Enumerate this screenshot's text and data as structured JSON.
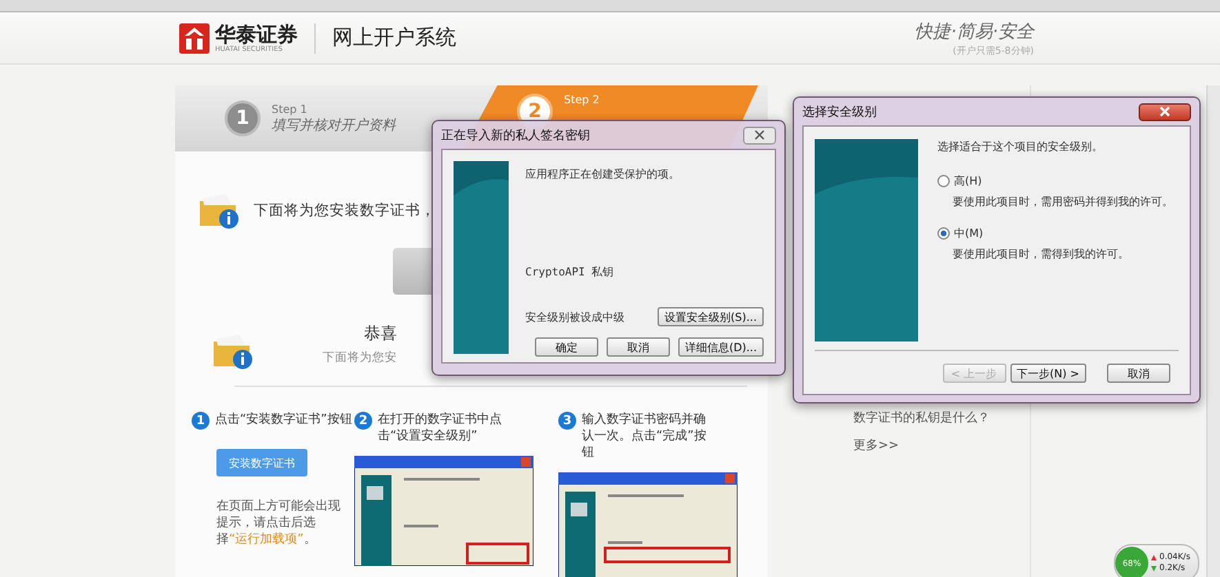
{
  "header": {
    "brand": "华泰证券",
    "brand_sub": "HUATAI SECURITIES",
    "title": "网上开户系统",
    "slogan": "快捷·简易·安全",
    "slogan_note": "(开户只需5-8分钟)"
  },
  "steps": [
    {
      "label": "Step 1",
      "number": "1",
      "title": "填写并核对开户资料",
      "selected": false
    },
    {
      "label": "Step 2",
      "number": "2",
      "selected": true
    }
  ],
  "notices": [
    {
      "kind": "line",
      "text": "下面将为您安装数字证书，"
    },
    {
      "kind": "heading",
      "heading": "恭喜",
      "text": "下面将为您安"
    }
  ],
  "guide": [
    {
      "kind": "button",
      "number": "1",
      "text": "点击“安装数字证书”按钮",
      "button": "安装数字证书",
      "note": [
        {
          "text": "在页面上方可能会出现提示，请点击后选择",
          "highlight": false
        },
        {
          "text": "“运行加载项”",
          "highlight": true
        },
        {
          "text": "。",
          "highlight": false
        }
      ]
    },
    {
      "kind": "screenshot",
      "number": "2",
      "text": "在打开的数字证书中点击“设置安全级别”"
    },
    {
      "kind": "screenshot",
      "number": "3",
      "text": "输入数字证书密码并确认一次。点击“完成”按钮"
    }
  ],
  "sidebar_links": [
    "数字证书的私钥是什么？",
    "更多>>"
  ],
  "import_dialog": {
    "title": "正在导入新的私人签名密钥",
    "message": "应用程序正在创建受保护的项。",
    "key_name": "CryptoAPI 私钥",
    "level_text": "安全级别被设成中级",
    "level_button": "设置安全级别(S)...",
    "buttons": [
      "确定",
      "取消",
      "详细信息(D)..."
    ]
  },
  "level_dialog": {
    "title": "选择安全级别",
    "prompt": "选择适合于这个项目的安全级别。",
    "options": [
      {
        "label": "高(H)",
        "description": "要使用此项目时，需用密码并得到我的许可。",
        "selected": false
      },
      {
        "label": "中(M)",
        "description": "要使用此项目时，需得到我的许可。",
        "selected": true
      }
    ],
    "buttons": [
      {
        "label": "< 上一步",
        "disabled": true
      },
      {
        "label": "下一步(N) >",
        "disabled": false
      },
      {
        "label": "取消",
        "disabled": false
      }
    ]
  },
  "net_widget": {
    "percent": "68%",
    "upload": "0.04K/s",
    "download": "0.2K/s"
  }
}
